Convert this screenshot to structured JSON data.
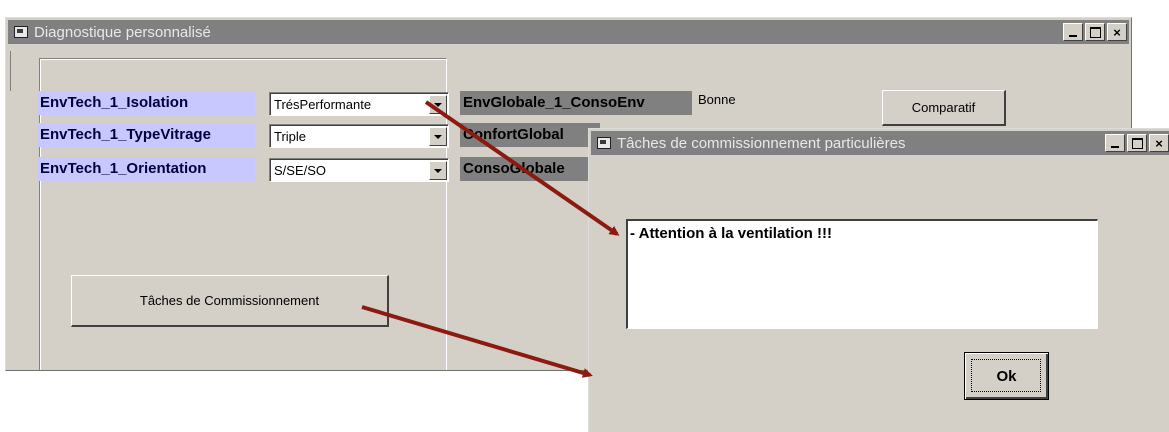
{
  "main_window": {
    "title": "Diagnostique personnalisé",
    "rows": [
      {
        "label": "EnvTech_1_Isolation",
        "value": "TrésPerformante"
      },
      {
        "label": "EnvTech_1_TypeVitrage",
        "value": "Triple"
      },
      {
        "label": "EnvTech_1_Orientation",
        "value": "S/SE/SO"
      }
    ],
    "outputs": [
      {
        "label": "EnvGlobale_1_ConsoEnv",
        "value": "Bonne"
      },
      {
        "label": "ConfortGlobal",
        "value": ""
      },
      {
        "label": "ConsoGlobale",
        "value": ""
      }
    ],
    "comparatif_button": "Comparatif",
    "commission_button": "Tâches de Commissionnement"
  },
  "dialog": {
    "title": "Tâches de commissionnement particulières",
    "message": "- Attention à la ventilation !!!",
    "ok_button": "Ok"
  },
  "titlebar_buttons": {
    "minimize": "_",
    "close": "×"
  },
  "colors": {
    "label_blue": "#c8c8ff",
    "label_gray": "#808080",
    "arrow": "#8b1a10",
    "window_face": "#d4d0c8"
  }
}
